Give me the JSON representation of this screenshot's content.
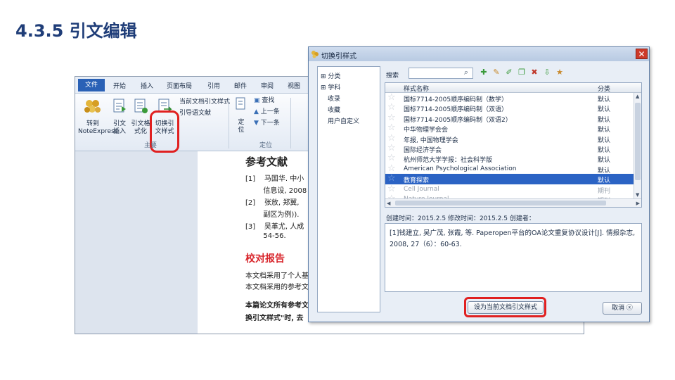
{
  "slide": {
    "title": "4.3.5 引文编辑"
  },
  "word": {
    "tabs": [
      "文件",
      "开始",
      "插入",
      "页面布局",
      "引用",
      "邮件",
      "审阅",
      "视图"
    ],
    "buttons": {
      "noteexpress": "转到\nNoteExpress",
      "insert_cite": "引文\n插入",
      "cite_format": "引文格\n式化",
      "switch_style": "切换引\n文样式"
    },
    "small_items": [
      "当前文档引文样式",
      "引导语文献"
    ],
    "nav_items": [
      "查找",
      "上一条",
      "下一条"
    ],
    "nav_button": "定\n位",
    "group_labels": [
      "主要",
      "定位"
    ],
    "document": {
      "heading": "参考文献",
      "refs": [
        "[1]    马国华. 中小",
        "        信息设, 2008",
        "[2]    张放, 郑翼,",
        "        副区为例)).",
        "[3]    吴革尤, 人成",
        "        54-56."
      ],
      "section_title": "校对报告",
      "body": [
        "本文档采用了个人基础",
        "本文档采用的参考文",
        "本篇论文所有参考文",
        "换引文样式\"时, 去"
      ]
    }
  },
  "dialog": {
    "title": "切换引样式",
    "close": "✕",
    "tree": [
      "分类",
      "学科",
      "收录",
      "收藏",
      "用户自定义"
    ],
    "search_label": "搜索",
    "search_placeholder": "",
    "columns": {
      "name": "样式名称",
      "type": "分类"
    },
    "rows": [
      {
        "name": "国标7714-2005顺序编码制（数学）",
        "type": "默认"
      },
      {
        "name": "国标7714-2005顺序编码制（双语）",
        "type": "默认"
      },
      {
        "name": "国标7714-2005顺序编码制（双语2）",
        "type": "默认"
      },
      {
        "name": "中华物理学会会",
        "type": "默认"
      },
      {
        "name": "    年报, 中国物理学会",
        "type": "默认"
      },
      {
        "name": "国际经济学会",
        "type": "默认"
      },
      {
        "name": "杭州师范大学学报：社会科学版",
        "type": "默认"
      },
      {
        "name": "American Psychological Association",
        "type": "默认"
      },
      {
        "name": "教育探索",
        "type": "默认"
      },
      {
        "name": "Cell Journal",
        "type": "期刊"
      },
      {
        "name": "Nature Journal",
        "type": "期刊"
      }
    ],
    "selected_index": 8,
    "info": "创建时间：2015.2.5    修改时间：2015.2.5    创建者：",
    "preview": "[1]钱建立, 吴广茂, 张霞, 等. Paperopen平台的OA论文重复协议设计[J]. 情报杂志, 2008, 27（6）：60-63.",
    "apply_button": "设为当前文档引文样式",
    "cancel_button": "取消 ⓧ"
  },
  "colors": {
    "title": "#1f3d78",
    "highlight": "#e02020",
    "selected": "#2b63c4"
  }
}
